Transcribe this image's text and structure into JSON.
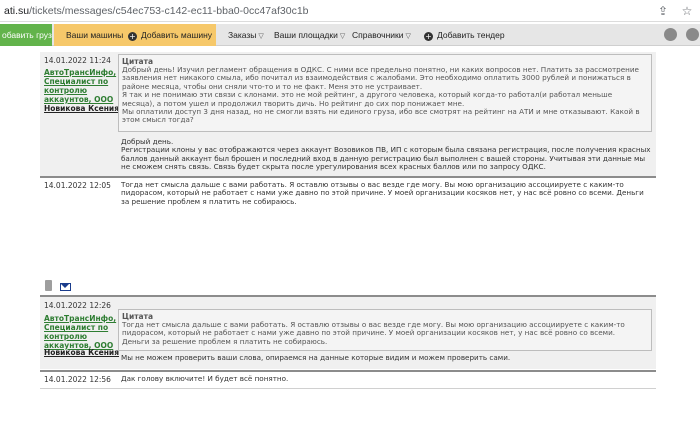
{
  "browser": {
    "url_host": "ati.su",
    "url_path": "/tickets/messages/c54ec753-c142-ec11-bba0-0cc47af30c1b"
  },
  "nav": {
    "add_cargo": "обавить груз",
    "my_trucks": "Ваши машины",
    "add_truck": "Добавить машину",
    "orders": "Заказы",
    "my_sites": "Ваши площадки",
    "references": "Справочники",
    "add_tender": "Добавить тендер"
  },
  "messages": [
    {
      "date": "14.01.2022 11:24",
      "company": "АвтоТрансИнфо, Специалист по контролю аккаунтов, ООО",
      "person": "Новикова Ксения",
      "quote_label": "Цитата",
      "quote": "Добрый день! Изучил регламент обращения в ОДКС. С ними все предельно понятно, ни каких вопросов нет. Платить за рассмотрение\nзаявления нет никакого смыла, ибо почитал из взаимодействия с жалобами. Это необходимо оплатить 3000 рублей и понижаться в\nрайоне месяца, чтобы они сняли что-то и то не факт. Меня это не устраивает.\nЯ так и не понимаю эти связи с клонами. это не мой рейтинг, а другого человека, который когда-то работал(и работал меньше\nмесяца), а потом ушел и продолжил творить дичь. Но рейтинг до сих пор понижает мне.\nМы оплатили доступ 3 дня назад, но не смогли взять ни единого груза, ибо все смотрят на рейтинг на АТИ и мне отказывают. Какой в\nэтом смысл тогда?",
      "text": "Добрый день.\nРегистрации клоны у вас отображаются через аккаунт Возовиков ПВ, ИП с которым была связана регистрация, после получения красных\nбаллов данный аккаунт был брошен и последний вход в данную регистрацию был выполнен с вашей стороны. Учитывая эти данные мы\nне сможем снять связь. Связь будет скрыта после урегулирования всех красных баллов или по запросу ОДКС."
    },
    {
      "date": "14.01.2022 12:05",
      "text": "Тогда нет смысла дальше с вами работать. Я оставлю отзывы о вас везде где могу. Вы мою организацию ассоциируете с каким-то\nпидорасом, который не работает с нами уже давно по этой причине. У моей организации косяков нет, у нас всё ровно со всеми. Деньги\nза решение проблем я платить не собираюсь."
    },
    {
      "date": "14.01.2022 12:26",
      "company": "АвтоТрансИнфо, Специалист по контролю аккаунтов, ООО",
      "person": "Новикова Ксения",
      "quote_label": "Цитата",
      "quote": "Тогда нет смысла дальше с вами работать. Я оставлю отзывы о вас везде где могу. Вы мою организацию ассоциируете с каким-то\nпидорасом, который не работает с нами уже давно по этой причине. У моей организации косяков нет, у нас всё ровно со всеми.\nДеньги за решение проблем я платить не собираюсь.",
      "text": "Мы не можем проверить ваши слова, опираемся на данные которые видим и можем проверить сами."
    },
    {
      "date": "14.01.2022 12:56",
      "text": "Дак голову включите! И будет всё понятно."
    }
  ]
}
